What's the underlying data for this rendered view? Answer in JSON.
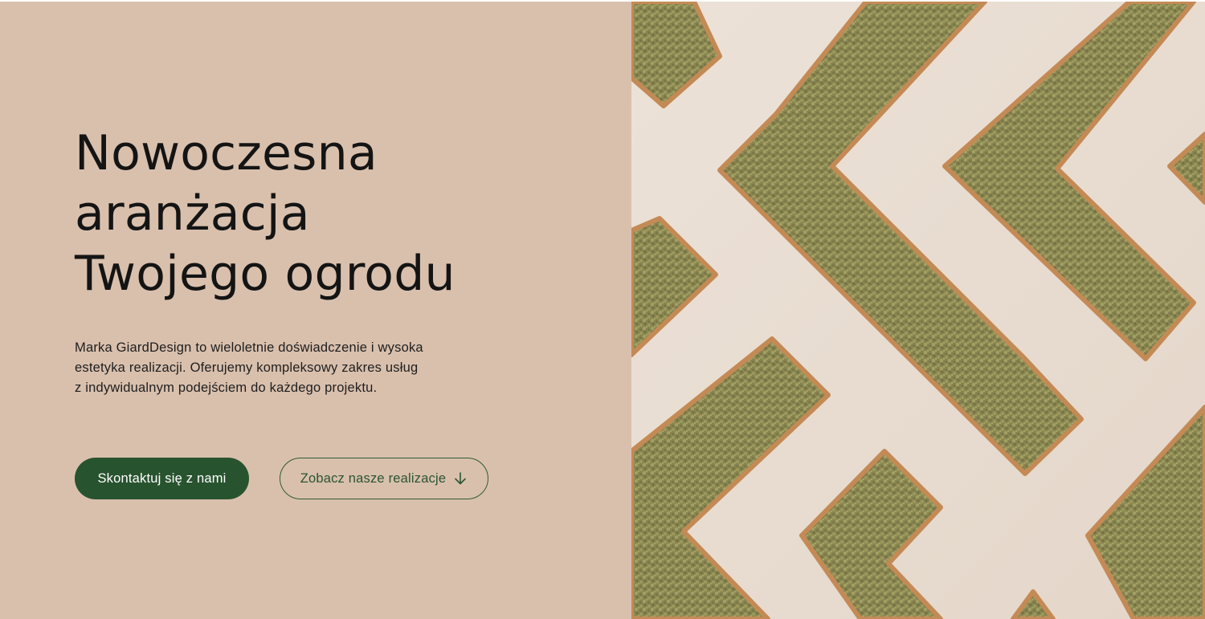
{
  "hero": {
    "title_lines": [
      "Nowoczesna",
      "aranżacja",
      "Twojego ogrodu"
    ],
    "description_lines": [
      "Marka GiardDesign to wieloletnie doświadczenie i wysoka",
      "estetyka realizacji. Oferujemy kompleksowy zakres usług",
      "z indywidualnym podejściem do każdego projektu."
    ],
    "primary_button": "Skontaktuj się z nami",
    "secondary_button": "Zobacz nasze realizacje",
    "secondary_button_icon": "arrow-down-icon"
  },
  "image": {
    "subject": "garden-hedge-maze-photo"
  },
  "colors": {
    "panel_background": "#d9c0ad",
    "accent_green": "#28532f",
    "text_dark": "#141414"
  }
}
